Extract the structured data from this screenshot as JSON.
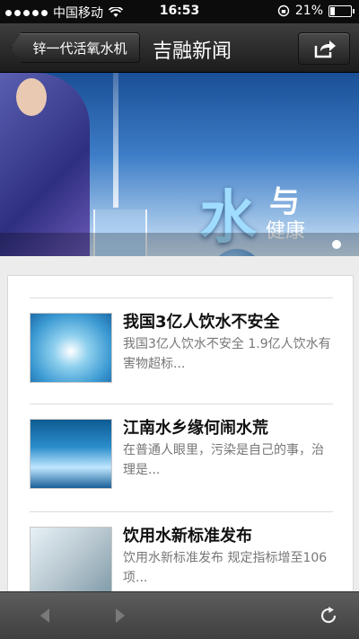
{
  "status_bar": {
    "carrier": "中国移动",
    "time": "16:53",
    "battery": "21%"
  },
  "nav": {
    "back_label": "锌一代活氧水机",
    "title": "吉融新闻"
  },
  "banner": {
    "headline_char": "水",
    "headline_and": "与",
    "headline_health": "健康",
    "slide_count": 1,
    "active_slide": 1
  },
  "news": [
    {
      "title": "我国3亿人饮水不安全",
      "summary": "我国3亿人饮水不安全 1.9亿人饮水有害物超标..."
    },
    {
      "title": "江南水乡缘何闹水荒",
      "summary": "在普通人眼里，污染是自己的事，治理是..."
    },
    {
      "title": "饮用水新标准发布",
      "summary": "饮用水新标准发布 规定指标增至106项..."
    }
  ],
  "toolbar": {
    "back_enabled": false,
    "forward_enabled": false
  },
  "colors": {
    "nav_bg": "#2b2b2b",
    "toolbar_bg": "#4d4d4d",
    "title_text": "#111111",
    "summary_text": "#777777"
  },
  "icons": {
    "share": "share-icon",
    "back": "back-arrow-icon",
    "forward": "forward-arrow-icon",
    "refresh": "refresh-icon"
  }
}
